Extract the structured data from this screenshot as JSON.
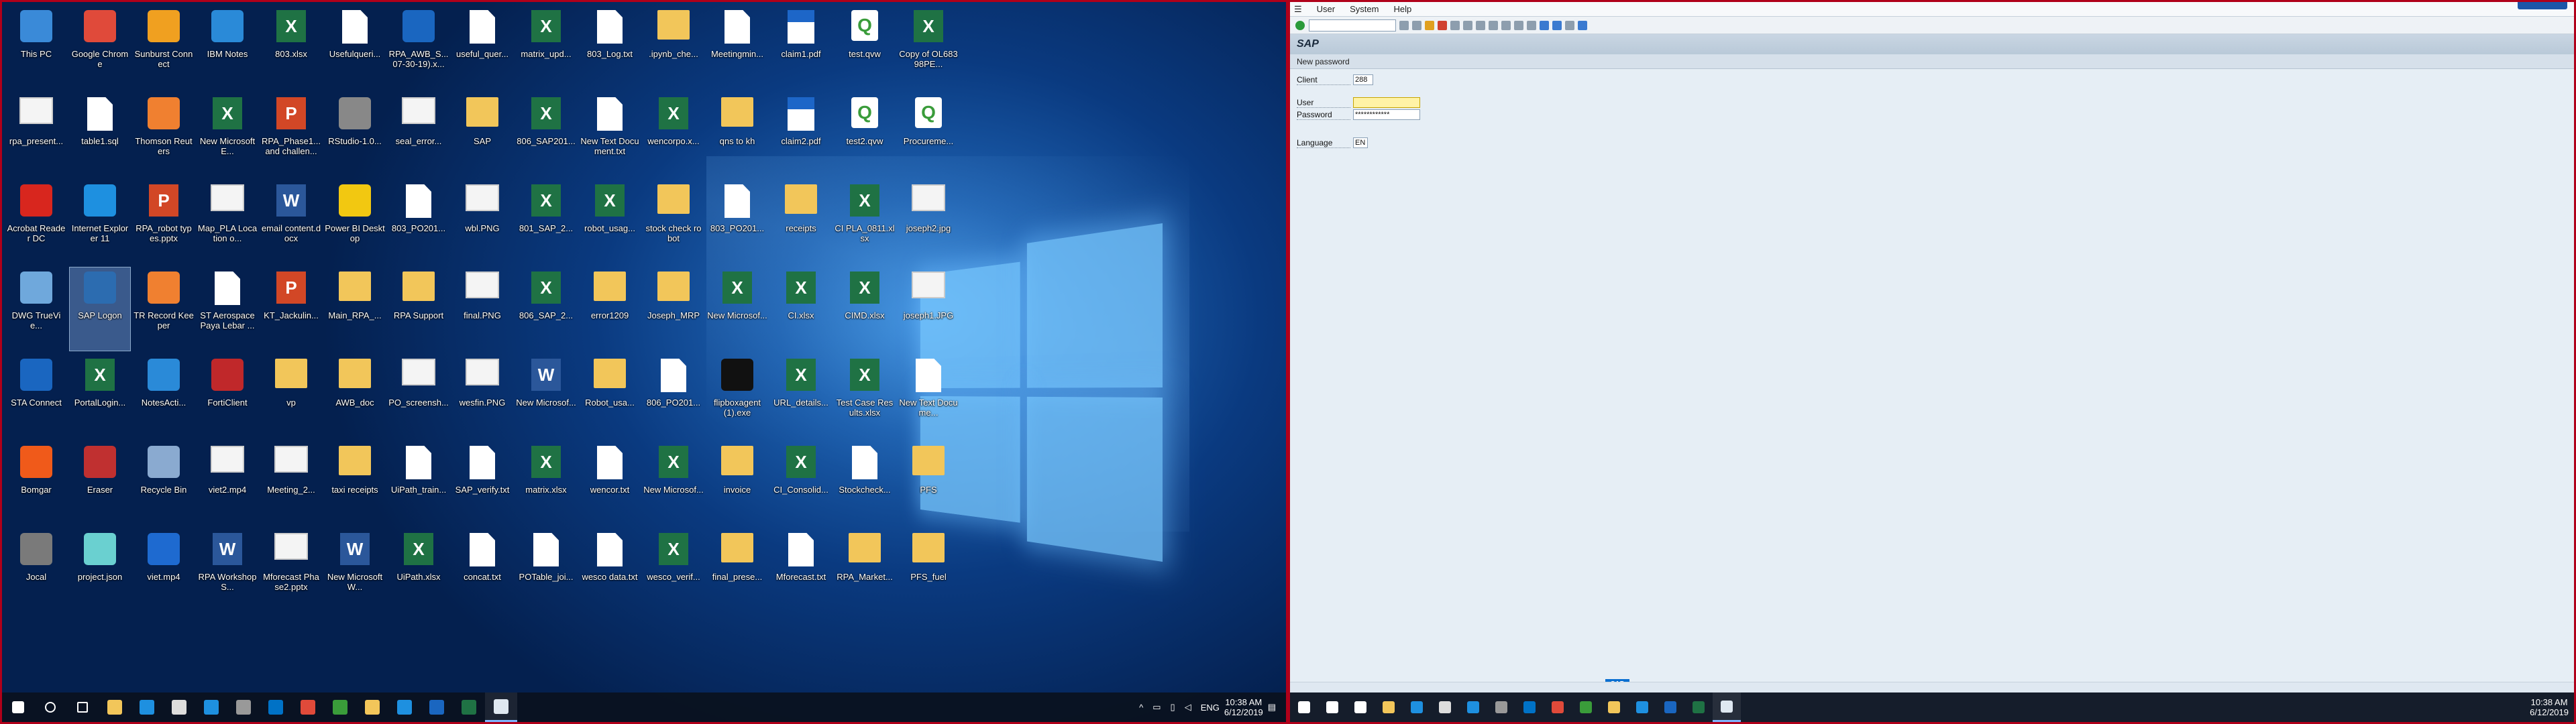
{
  "desktop_icons": [
    {
      "label": "This PC",
      "type": "app",
      "color": "#3a8ad8"
    },
    {
      "label": "Google Chrome",
      "type": "app",
      "color": "#e04a3a"
    },
    {
      "label": "Sunburst Connect",
      "type": "app",
      "color": "#f0a020"
    },
    {
      "label": "IBM Notes",
      "type": "app",
      "color": "#2a8ad8"
    },
    {
      "label": "803.xlsx",
      "type": "xl"
    },
    {
      "label": "Usefulqueri...",
      "type": "doc"
    },
    {
      "label": "RPA_AWB_S... 07-30-19).x...",
      "type": "app",
      "color": "#1a66c0"
    },
    {
      "label": "useful_quer...",
      "type": "doc"
    },
    {
      "label": "matrix_upd...",
      "type": "xl"
    },
    {
      "label": "803_Log.txt",
      "type": "doc"
    },
    {
      "label": ".ipynb_che...",
      "type": "fold"
    },
    {
      "label": "Meetingmin...",
      "type": "doc"
    },
    {
      "label": "claim1.pdf",
      "type": "pdf"
    },
    {
      "label": "test.qvw",
      "type": "qv"
    },
    {
      "label": "Copy of OL68398PE...",
      "type": "xl"
    },
    {
      "label": "rpa_present...",
      "type": "img"
    },
    {
      "label": "table1.sql",
      "type": "doc"
    },
    {
      "label": "Thomson Reuters",
      "type": "app",
      "color": "#f08030"
    },
    {
      "label": "New Microsoft E...",
      "type": "xl"
    },
    {
      "label": "RPA_Phase1... and challen...",
      "type": "pp"
    },
    {
      "label": "RStudio-1.0...",
      "type": "app",
      "color": "#888"
    },
    {
      "label": "seal_error...",
      "type": "img"
    },
    {
      "label": "SAP",
      "type": "fold"
    },
    {
      "label": "806_SAP201...",
      "type": "xl"
    },
    {
      "label": "New Text Document.txt",
      "type": "doc"
    },
    {
      "label": "wencorpo.x...",
      "type": "xl"
    },
    {
      "label": "qns to kh",
      "type": "fold"
    },
    {
      "label": "claim2.pdf",
      "type": "pdf"
    },
    {
      "label": "test2.qvw",
      "type": "qv"
    },
    {
      "label": "Procureme...",
      "type": "qv"
    },
    {
      "label": "Acrobat Reader DC",
      "type": "app",
      "color": "#d8261e"
    },
    {
      "label": "Internet Explorer 11",
      "type": "app",
      "color": "#1e90e0"
    },
    {
      "label": "RPA_robot types.pptx",
      "type": "pp"
    },
    {
      "label": "Map_PLA Location o...",
      "type": "img"
    },
    {
      "label": "email content.docx",
      "type": "wd"
    },
    {
      "label": "Power BI Desktop",
      "type": "app",
      "color": "#f2c811"
    },
    {
      "label": "803_PO201...",
      "type": "doc"
    },
    {
      "label": "wbl.PNG",
      "type": "img"
    },
    {
      "label": "801_SAP_2...",
      "type": "xl"
    },
    {
      "label": "robot_usag...",
      "type": "xl"
    },
    {
      "label": "stock check robot",
      "type": "fold"
    },
    {
      "label": "803_PO201...",
      "type": "doc"
    },
    {
      "label": "receipts",
      "type": "fold"
    },
    {
      "label": "CI PLA_0811.xlsx",
      "type": "xl"
    },
    {
      "label": "joseph2.jpg",
      "type": "img"
    },
    {
      "label": "DWG TrueVie...",
      "type": "app",
      "color": "#6fa8dc"
    },
    {
      "label": "SAP Logon",
      "type": "app",
      "color": "#2c6cb0",
      "selected": true
    },
    {
      "label": "TR Record Keeper",
      "type": "app",
      "color": "#f08030"
    },
    {
      "label": "ST Aerospace Paya Lebar ...",
      "type": "doc"
    },
    {
      "label": "KT_Jackulin...",
      "type": "pp"
    },
    {
      "label": "Main_RPA_...",
      "type": "fold"
    },
    {
      "label": "RPA Support",
      "type": "fold"
    },
    {
      "label": "final.PNG",
      "type": "img"
    },
    {
      "label": "806_SAP_2...",
      "type": "xl"
    },
    {
      "label": "error1209",
      "type": "fold"
    },
    {
      "label": "Joseph_MRP",
      "type": "fold"
    },
    {
      "label": "New Microsof...",
      "type": "xl"
    },
    {
      "label": "CI.xlsx",
      "type": "xl"
    },
    {
      "label": "CIMD.xlsx",
      "type": "xl"
    },
    {
      "label": "joseph1.JPG",
      "type": "img"
    },
    {
      "label": "STA Connect",
      "type": "app",
      "color": "#1a66c0"
    },
    {
      "label": "PortalLogin...",
      "type": "xl"
    },
    {
      "label": "NotesActi...",
      "type": "app",
      "color": "#2a8ad8"
    },
    {
      "label": "FortiClient",
      "type": "app",
      "color": "#c0282a"
    },
    {
      "label": "vp",
      "type": "fold"
    },
    {
      "label": "AWB_doc",
      "type": "fold"
    },
    {
      "label": "PO_screensh...",
      "type": "img"
    },
    {
      "label": "wesfin.PNG",
      "type": "img"
    },
    {
      "label": "New Microsof...",
      "type": "wd"
    },
    {
      "label": "Robot_usa...",
      "type": "fold"
    },
    {
      "label": "806_PO201...",
      "type": "doc"
    },
    {
      "label": "flipboxagent (1).exe",
      "type": "app",
      "color": "#111"
    },
    {
      "label": "URL_details...",
      "type": "xl"
    },
    {
      "label": "Test Case Results.xlsx",
      "type": "xl"
    },
    {
      "label": "New Text Docume...",
      "type": "doc"
    },
    {
      "label": "Bomgar",
      "type": "app",
      "color": "#f05a1a"
    },
    {
      "label": "Eraser",
      "type": "app",
      "color": "#c03030"
    },
    {
      "label": "Recycle Bin",
      "type": "app",
      "color": "#8aaad0"
    },
    {
      "label": "viet2.mp4",
      "type": "img"
    },
    {
      "label": "Meeting_2...",
      "type": "img"
    },
    {
      "label": "taxi receipts",
      "type": "fold"
    },
    {
      "label": "UiPath_train...",
      "type": "doc"
    },
    {
      "label": "SAP_verify.txt",
      "type": "doc"
    },
    {
      "label": "matrix.xlsx",
      "type": "xl"
    },
    {
      "label": "wencor.txt",
      "type": "doc"
    },
    {
      "label": "New Microsof...",
      "type": "xl"
    },
    {
      "label": "invoice",
      "type": "fold"
    },
    {
      "label": "CI_Consolid...",
      "type": "xl"
    },
    {
      "label": "Stockcheck...",
      "type": "doc"
    },
    {
      "label": "PFS",
      "type": "fold"
    },
    {
      "label": "Jocal",
      "type": "app",
      "color": "#7a7a7a"
    },
    {
      "label": "project.json",
      "type": "app",
      "color": "#6ad0d0"
    },
    {
      "label": "viet.mp4",
      "type": "app",
      "color": "#1e6ad0"
    },
    {
      "label": "RPA Workshop S...",
      "type": "wd"
    },
    {
      "label": "Mforecast Phase2.pptx",
      "type": "img"
    },
    {
      "label": "New Microsoft W...",
      "type": "wd"
    },
    {
      "label": "UiPath.xlsx",
      "type": "xl"
    },
    {
      "label": "concat.txt",
      "type": "doc"
    },
    {
      "label": "POTable_joi...",
      "type": "doc"
    },
    {
      "label": "wesco data.txt",
      "type": "doc"
    },
    {
      "label": "wesco_verif...",
      "type": "xl"
    },
    {
      "label": "final_prese...",
      "type": "fold"
    },
    {
      "label": "Mforecast.txt",
      "type": "doc"
    },
    {
      "label": "RPA_Market...",
      "type": "fold"
    },
    {
      "label": "PFS_fuel",
      "type": "fold"
    }
  ],
  "taskbar1": {
    "items": [
      {
        "name": "start",
        "color": "#fff"
      },
      {
        "name": "search",
        "color": "#fff"
      },
      {
        "name": "task-view",
        "color": "#fff"
      },
      {
        "name": "explorer",
        "color": "#f2c65a"
      },
      {
        "name": "edge",
        "color": "#1e90e0"
      },
      {
        "name": "store",
        "color": "#ddd"
      },
      {
        "name": "ie",
        "color": "#1e90e0"
      },
      {
        "name": "tools",
        "color": "#999"
      },
      {
        "name": "outlook",
        "color": "#0072c6"
      },
      {
        "name": "chrome",
        "color": "#e04a3a"
      },
      {
        "name": "qlik",
        "color": "#3a9c3a"
      },
      {
        "name": "notes",
        "color": "#f2c65a"
      },
      {
        "name": "ie2",
        "color": "#1e90e0"
      },
      {
        "name": "uipath",
        "color": "#1a66c0"
      },
      {
        "name": "excel",
        "color": "#1f7244"
      },
      {
        "name": "sap",
        "color": "#dfe8f1",
        "active": true
      }
    ],
    "lang": "ENG",
    "time": "10:38 AM",
    "date": "6/12/2019"
  },
  "taskbar2": {
    "time": "10:38 AM",
    "date": "6/12/2019"
  },
  "sap": {
    "menu": [
      "User",
      "System",
      "Help"
    ],
    "title": "SAP",
    "appbar": "New password",
    "client_label": "Client",
    "client_value": "288",
    "user_label": "User",
    "user_value": "",
    "password_label": "Password",
    "password_value": "************",
    "language_label": "Language",
    "language_value": "EN",
    "logo": "SAP"
  }
}
